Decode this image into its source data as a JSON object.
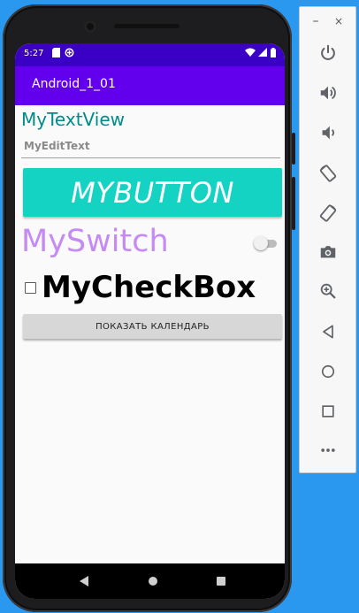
{
  "status_bar": {
    "time": "5:27"
  },
  "app_bar": {
    "title": "Android_1_01"
  },
  "main": {
    "text_view": "MyTextView",
    "edit_text_value": "MyEditText",
    "button_label": "MYBUTTON",
    "switch_label": "MySwitch",
    "switch_checked": false,
    "checkbox_label": "MyCheckBox",
    "checkbox_checked": false,
    "calendar_button_label": "ПОКАЗАТЬ КАЛЕНДАРЬ"
  },
  "emulator_toolbar": {
    "minimize_label": "–",
    "close_label": "×",
    "tools": [
      "power-icon",
      "volume-up-icon",
      "volume-down-icon",
      "rotate-left-icon",
      "rotate-right-icon",
      "camera-icon",
      "zoom-icon",
      "back-icon",
      "home-icon",
      "overview-icon",
      "more-icon"
    ]
  },
  "colors": {
    "status_bar": "#3a00c6",
    "app_bar": "#6200ee",
    "text_view": "#008b8b",
    "button_bg": "#14d3c2",
    "switch_text": "#c58af4",
    "toolbar_icon": "#5f6368"
  }
}
